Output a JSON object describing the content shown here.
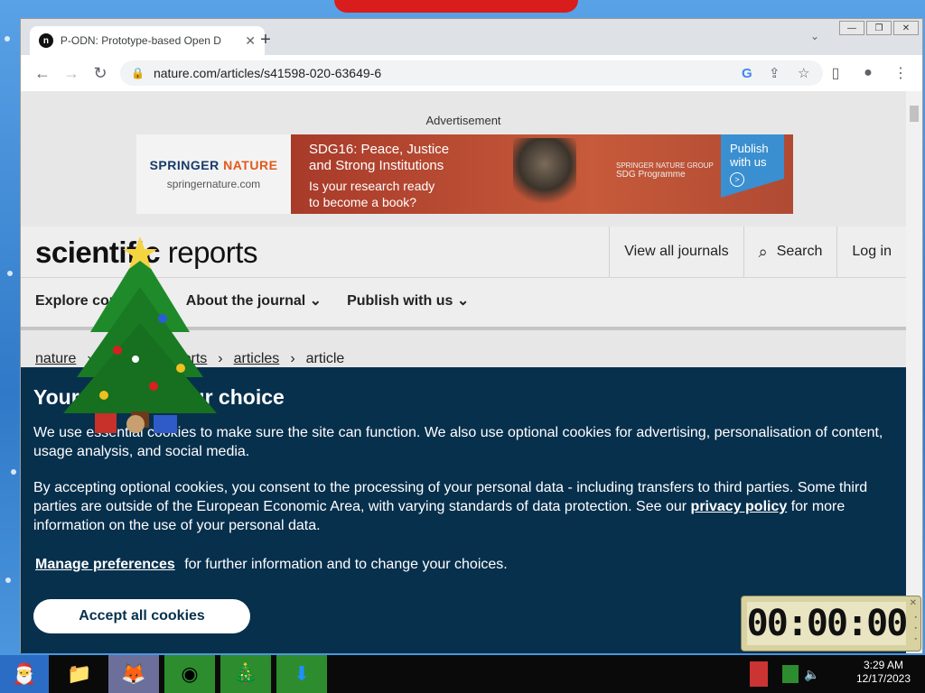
{
  "browser": {
    "tab_title": "P-ODN: Prototype-based Open D",
    "tab_favicon": "n",
    "new_tab": "+",
    "url": "nature.com/articles/s41598-020-63649-6"
  },
  "ad": {
    "label": "Advertisement",
    "brand_part1": "SPRINGER",
    "brand_part2": "NATURE",
    "site": "springernature.com",
    "headline_line1": "SDG16: Peace, Justice",
    "headline_line2": "and Strong Institutions",
    "question_line1": "Is your research ready",
    "question_line2": "to become a book?",
    "sdg_line1": "SPRINGER NATURE GROUP",
    "sdg_line2": "SDG Programme",
    "cta_line1": "Publish",
    "cta_line2": "with us"
  },
  "site": {
    "logo_bold": "scientific",
    "logo_light": "reports",
    "nav_view_all": "View all journals",
    "nav_search": "Search",
    "nav_login": "Log in",
    "subnav": [
      "Explore content",
      "About the journal",
      "Publish with us"
    ]
  },
  "breadcrumb": [
    "nature",
    "scientific reports",
    "articles",
    "article"
  ],
  "cookie": {
    "title": "Your privacy, your choice",
    "p1": "We use essential cookies to make sure the site can function. We also use optional cookies for advertising, personalisation of content, usage analysis, and social media.",
    "p2_before": "By accepting optional cookies, you consent to the processing of your personal data - including transfers to third parties. Some third parties are outside of the European Economic Area, with varying standards of data protection. See our ",
    "p2_link": "privacy policy",
    "p2_after": " for more information on the use of your personal data.",
    "p3_link": "Manage preferences",
    "p3_after": "for further information and to change your choices.",
    "accept": "Accept all cookies"
  },
  "timer": {
    "display": "00:00:00"
  },
  "taskbar": {
    "time": "3:29 AM",
    "date": "12/17/2023"
  },
  "icons": [
    "tree-decoration-icon",
    "search-icon",
    "lock-icon",
    "star-icon",
    "google-icon",
    "share-icon",
    "profile-icon",
    "menu-icon"
  ]
}
